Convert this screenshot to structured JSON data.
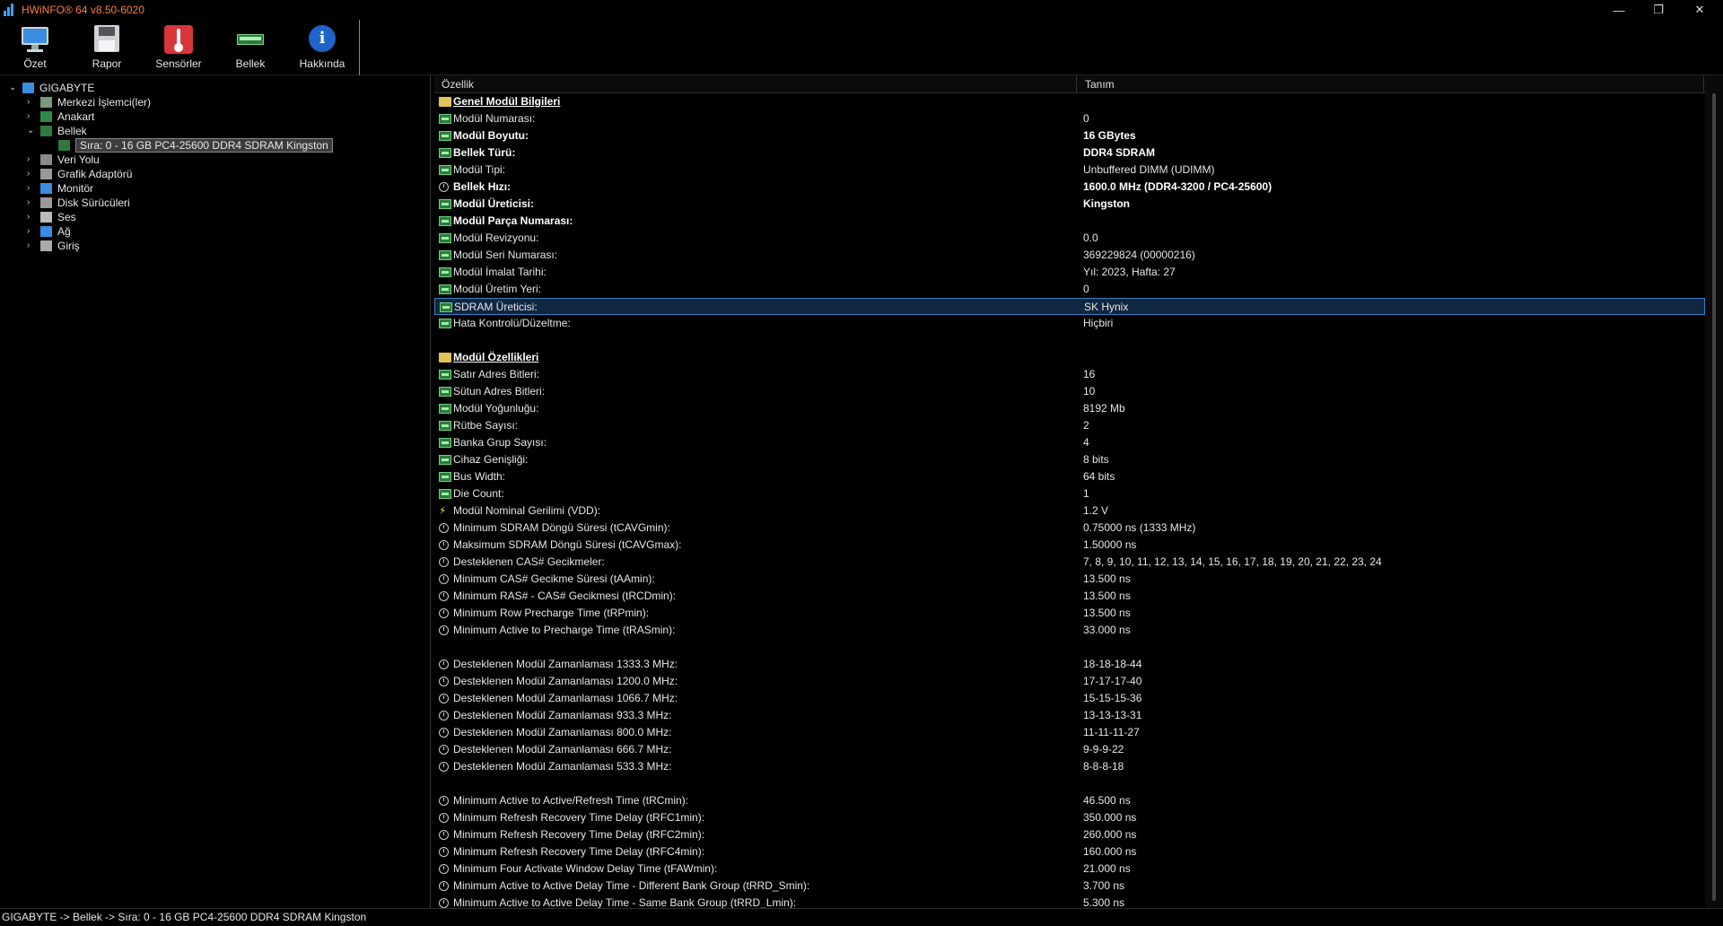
{
  "window": {
    "title": "HWiNFO® 64 v8.50-6020",
    "minimize": "—",
    "maximize": "❐",
    "close": "✕"
  },
  "toolbar": [
    {
      "label": "Özet",
      "icon": "monitor-icon"
    },
    {
      "label": "Rapor",
      "icon": "floppy-disk-icon"
    },
    {
      "label": "Sensörler",
      "icon": "thermometer-icon"
    },
    {
      "label": "Bellek",
      "icon": "memory-module-icon"
    },
    {
      "label": "Hakkında",
      "icon": "info-icon"
    }
  ],
  "tree": [
    {
      "label": "GIGABYTE",
      "chev": "⌄",
      "icon": "computer-icon",
      "level": 0
    },
    {
      "label": "Merkezi İşlemci(ler)",
      "chev": "›",
      "icon": "cpu-icon",
      "level": 1
    },
    {
      "label": "Anakart",
      "chev": "›",
      "icon": "motherboard-icon",
      "level": 1
    },
    {
      "label": "Bellek",
      "chev": "⌄",
      "icon": "memory-icon",
      "level": 1
    },
    {
      "label": "Sıra: 0 - 16 GB PC4-25600 DDR4 SDRAM Kingston",
      "chev": "",
      "icon": "memory-module-icon",
      "level": 2,
      "selected": true
    },
    {
      "label": "Veri Yolu",
      "chev": "›",
      "icon": "bus-icon",
      "level": 1
    },
    {
      "label": "Grafik Adaptörü",
      "chev": "›",
      "icon": "gpu-icon",
      "level": 1
    },
    {
      "label": "Monitör",
      "chev": "›",
      "icon": "display-icon",
      "level": 1
    },
    {
      "label": "Disk Sürücüleri",
      "chev": "›",
      "icon": "disk-icon",
      "level": 1
    },
    {
      "label": "Ses",
      "chev": "›",
      "icon": "speaker-icon",
      "level": 1
    },
    {
      "label": "Ağ",
      "chev": "›",
      "icon": "network-icon",
      "level": 1
    },
    {
      "label": "Giriş",
      "chev": "›",
      "icon": "input-icon",
      "level": 1
    }
  ],
  "columns": {
    "property": "Özellik",
    "value": "Tanım"
  },
  "rows": [
    {
      "name": "Genel Modül Bilgileri",
      "value": "",
      "kind": "section",
      "icon": "folder-icon"
    },
    {
      "name": "Modül Numarası:",
      "value": "0",
      "icon": "ram-icon"
    },
    {
      "name": "Modül Boyutu:",
      "value": "16 GBytes",
      "icon": "ram-icon",
      "bold": true
    },
    {
      "name": "Bellek Türü:",
      "value": "DDR4 SDRAM",
      "icon": "ram-icon",
      "bold": true
    },
    {
      "name": "Modül Tipi:",
      "value": "Unbuffered DIMM (UDIMM)",
      "icon": "ram-icon"
    },
    {
      "name": "Bellek Hızı:",
      "value": "1600.0 MHz (DDR4-3200 / PC4-25600)",
      "icon": "clock-icon",
      "bold": true
    },
    {
      "name": "Modül Üreticisi:",
      "value": "Kingston",
      "icon": "ram-icon",
      "bold": true
    },
    {
      "name": "Modül Parça Numarası:",
      "value": "",
      "icon": "ram-icon",
      "bold": true
    },
    {
      "name": "Modül Revizyonu:",
      "value": "0.0",
      "icon": "ram-icon"
    },
    {
      "name": "Modül Seri Numarası:",
      "value": "369229824 (00000216)",
      "icon": "ram-icon"
    },
    {
      "name": "Modül İmalat Tarihi:",
      "value": "Yıl: 2023, Hafta: 27",
      "icon": "ram-icon"
    },
    {
      "name": "Modül Üretim Yeri:",
      "value": "0",
      "icon": "ram-icon"
    },
    {
      "name": "SDRAM Üreticisi:",
      "value": "SK Hynix",
      "icon": "ram-icon",
      "selected": true
    },
    {
      "name": "Hata Kontrolü/Düzeltme:",
      "value": "Hiçbiri",
      "icon": "ram-icon"
    },
    {
      "name": "",
      "value": "",
      "kind": "blank"
    },
    {
      "name": "Modül Özellikleri",
      "value": "",
      "kind": "section",
      "icon": "folder-icon"
    },
    {
      "name": "Satır Adres Bitleri:",
      "value": "16",
      "icon": "ram-icon"
    },
    {
      "name": "Sütun Adres Bitleri:",
      "value": "10",
      "icon": "ram-icon"
    },
    {
      "name": "Modül Yoğunluğu:",
      "value": "8192 Mb",
      "icon": "ram-icon"
    },
    {
      "name": "Rütbe Sayısı:",
      "value": "2",
      "icon": "ram-icon"
    },
    {
      "name": "Banka Grup Sayısı:",
      "value": "4",
      "icon": "ram-icon"
    },
    {
      "name": "Cihaz Genişliği:",
      "value": "8 bits",
      "icon": "ram-icon"
    },
    {
      "name": "Bus Width:",
      "value": "64 bits",
      "icon": "ram-icon"
    },
    {
      "name": "Die Count:",
      "value": "1",
      "icon": "ram-icon"
    },
    {
      "name": "Modül Nominal Gerilimi (VDD):",
      "value": "1.2 V",
      "icon": "bolt-icon"
    },
    {
      "name": "Minimum SDRAM Döngü Süresi (tCAVGmin):",
      "value": "0.75000 ns (1333 MHz)",
      "icon": "clock-icon"
    },
    {
      "name": "Maksimum SDRAM Döngü Süresi (tCAVGmax):",
      "value": "1.50000 ns",
      "icon": "clock-icon"
    },
    {
      "name": "Desteklenen CAS# Gecikmeler:",
      "value": "7, 8, 9, 10, 11, 12, 13, 14, 15, 16, 17, 18, 19, 20, 21, 22, 23, 24",
      "icon": "clock-icon"
    },
    {
      "name": "Minimum CAS# Gecikme Süresi (tAAmin):",
      "value": "13.500 ns",
      "icon": "clock-icon"
    },
    {
      "name": "Minimum RAS# - CAS# Gecikmesi (tRCDmin):",
      "value": "13.500 ns",
      "icon": "clock-icon"
    },
    {
      "name": "Minimum Row Precharge Time (tRPmin):",
      "value": "13.500 ns",
      "icon": "clock-icon"
    },
    {
      "name": "Minimum Active to Precharge Time (tRASmin):",
      "value": "33.000 ns",
      "icon": "clock-icon"
    },
    {
      "name": "",
      "value": "",
      "kind": "blank"
    },
    {
      "name": "Desteklenen Modül Zamanlaması 1333.3 MHz:",
      "value": "18-18-18-44",
      "icon": "clock-icon"
    },
    {
      "name": "Desteklenen Modül Zamanlaması 1200.0 MHz:",
      "value": "17-17-17-40",
      "icon": "clock-icon"
    },
    {
      "name": "Desteklenen Modül Zamanlaması 1066.7 MHz:",
      "value": "15-15-15-36",
      "icon": "clock-icon"
    },
    {
      "name": "Desteklenen Modül Zamanlaması 933.3 MHz:",
      "value": "13-13-13-31",
      "icon": "clock-icon"
    },
    {
      "name": "Desteklenen Modül Zamanlaması 800.0 MHz:",
      "value": "11-11-11-27",
      "icon": "clock-icon"
    },
    {
      "name": "Desteklenen Modül Zamanlaması 666.7 MHz:",
      "value": "9-9-9-22",
      "icon": "clock-icon"
    },
    {
      "name": "Desteklenen Modül Zamanlaması 533.3 MHz:",
      "value": "8-8-8-18",
      "icon": "clock-icon"
    },
    {
      "name": "",
      "value": "",
      "kind": "blank"
    },
    {
      "name": "Minimum Active to Active/Refresh Time (tRCmin):",
      "value": "46.500 ns",
      "icon": "clock-icon"
    },
    {
      "name": "Minimum Refresh Recovery Time Delay (tRFC1min):",
      "value": "350.000 ns",
      "icon": "clock-icon"
    },
    {
      "name": "Minimum Refresh Recovery Time Delay (tRFC2min):",
      "value": "260.000 ns",
      "icon": "clock-icon"
    },
    {
      "name": "Minimum Refresh Recovery Time Delay (tRFC4min):",
      "value": "160.000 ns",
      "icon": "clock-icon"
    },
    {
      "name": "Minimum Four Activate Window Delay Time (tFAWmin):",
      "value": "21.000 ns",
      "icon": "clock-icon"
    },
    {
      "name": "Minimum Active to Active Delay Time - Different Bank Group (tRRD_Smin):",
      "value": "3.700 ns",
      "icon": "clock-icon"
    },
    {
      "name": "Minimum Active to Active Delay Time - Same Bank Group (tRRD_Lmin):",
      "value": "5.300 ns",
      "icon": "clock-icon"
    }
  ],
  "status": "GIGABYTE -> Bellek -> Sıra: 0 - 16 GB PC4-25600 DDR4 SDRAM Kingston"
}
